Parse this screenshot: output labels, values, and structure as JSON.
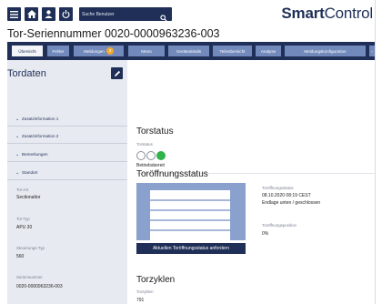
{
  "app": {
    "logo_bold": "Smart",
    "logo_light": "Control",
    "title": "Tor-Seriennummer 0020-0000963236-003"
  },
  "search": {
    "placeholder": "Suche Benutzer"
  },
  "tabs": [
    {
      "label": "Übersicht",
      "active": true
    },
    {
      "label": "Fehler",
      "active": false
    },
    {
      "label": "Meldungen",
      "badge": "3",
      "active": false
    },
    {
      "label": "Menü",
      "active": false
    },
    {
      "label": "Gerätedetails",
      "active": false
    },
    {
      "label": "Teileübersicht",
      "active": false
    },
    {
      "label": "Analyse",
      "active": false
    },
    {
      "label": "Meldungskonfiguration",
      "active": false
    }
  ],
  "sidebar": {
    "heading": "Tordaten",
    "sections": [
      {
        "label": "Zusatzinformation 1"
      },
      {
        "label": "Zusatzinformation 2"
      },
      {
        "label": "Bemerkungen"
      },
      {
        "label": "Standort"
      }
    ],
    "fields": [
      {
        "label": "Tor-Art",
        "value": "Sectionaltor"
      },
      {
        "label": "Tor-Typ",
        "value": "APU 30"
      },
      {
        "label": "Steuerungs-Typ",
        "value": "560"
      },
      {
        "label": "Seriennummer",
        "value": "0020-0000963236-003"
      }
    ]
  },
  "torstatus": {
    "heading": "Torstatus",
    "label": "Torstatus",
    "value": "Betriebsbereit",
    "colors": {
      "active": "#2fb34a",
      "inactive": "#ffffff"
    }
  },
  "oeffnung": {
    "heading": "Toröffnungsstatus",
    "status_label": "Toröffnungsstatus",
    "status_date": "08.10.2020 08:19 CEST",
    "status_value": "Endlage unten / geschlossen",
    "position_label": "Toröffnungsposition",
    "position_value": "0%",
    "button_label": "Aktuellen Toröffnungsstatus anfordern"
  },
  "zyklen": {
    "heading": "Torzyklen",
    "label": "Torzyklen",
    "value": "791"
  },
  "colors": {
    "navy": "#1f2f57",
    "tab": "#7189bb",
    "sidebar": "#e7eaf0",
    "badge": "#f0a92b"
  }
}
